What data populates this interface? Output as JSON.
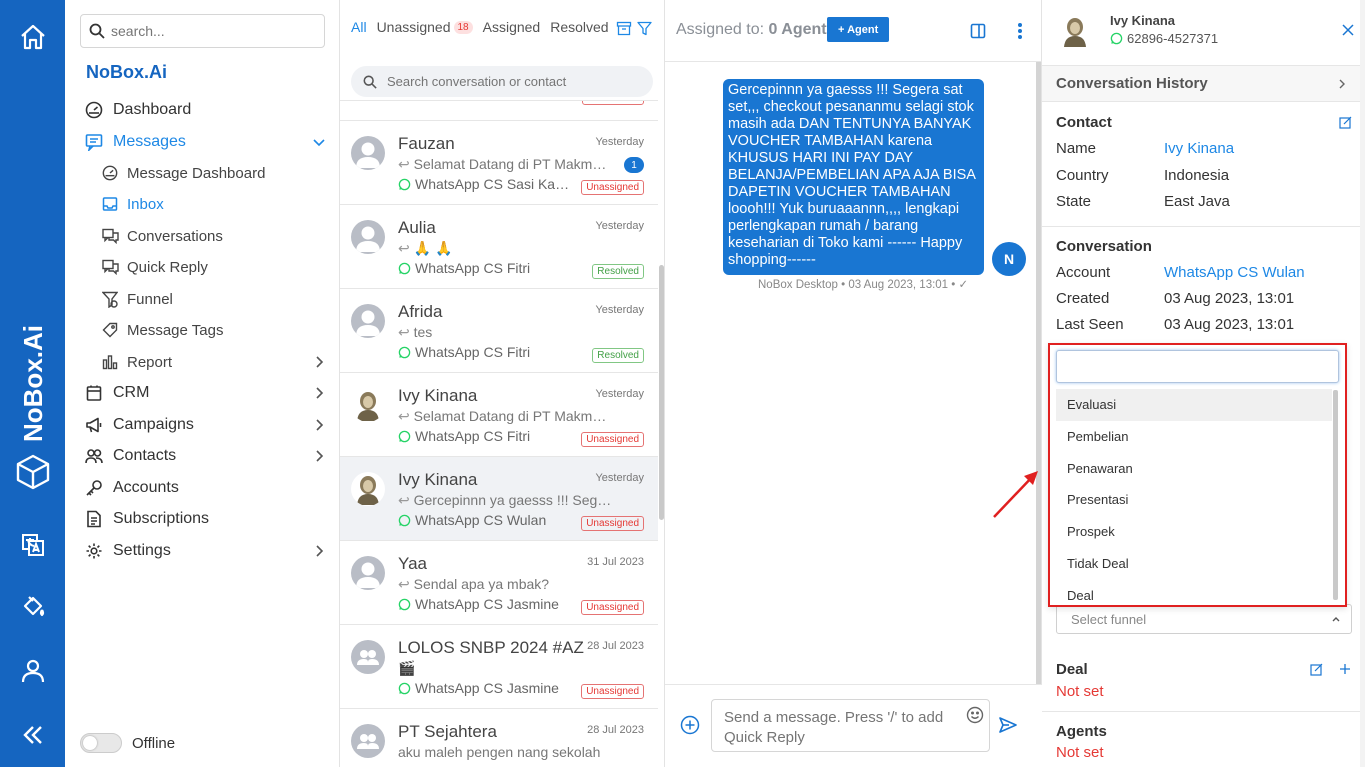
{
  "rail": {
    "brand": "NoBox.Ai",
    "icons": [
      "home-icon",
      "translate-icon",
      "paint-bucket-icon",
      "user-icon",
      "collapse-icon"
    ],
    "accent": "#1565c0"
  },
  "sidebar": {
    "search_placeholder": "search...",
    "brand": "NoBox.Ai",
    "items": [
      {
        "label": "Dashboard"
      },
      {
        "label": "Messages"
      },
      {
        "label": "Message Dashboard"
      },
      {
        "label": "Inbox"
      },
      {
        "label": "Conversations"
      },
      {
        "label": "Quick Reply"
      },
      {
        "label": "Funnel"
      },
      {
        "label": "Message Tags"
      },
      {
        "label": "Report"
      },
      {
        "label": "CRM"
      },
      {
        "label": "Campaigns"
      },
      {
        "label": "Contacts"
      },
      {
        "label": "Accounts"
      },
      {
        "label": "Subscriptions"
      },
      {
        "label": "Settings"
      }
    ],
    "status": "Offline"
  },
  "convlist": {
    "tabs": [
      "All",
      "Unassigned",
      "Assigned",
      "Resolved"
    ],
    "unassigned_count": "18",
    "search_placeholder": "Search conversation or contact",
    "items": [
      {
        "name": "Fauzan",
        "date": "Yesterday",
        "preview": "Selamat Datang di PT Makmur Sejahtera",
        "channel": "WhatsApp CS Sasi Kanti...",
        "badge": "Unassigned",
        "unread": "1"
      },
      {
        "name": "Aulia",
        "date": "Yesterday",
        "preview": "🙏 🙏",
        "channel": "WhatsApp CS Fitri",
        "badge": "Resolved"
      },
      {
        "name": "Afrida",
        "date": "Yesterday",
        "preview": "tes",
        "channel": "WhatsApp CS Fitri",
        "badge": "Resolved"
      },
      {
        "name": "Ivy Kinana",
        "date": "Yesterday",
        "preview": "Selamat Datang di PT Makmur Sejahtera",
        "channel": "WhatsApp CS Fitri",
        "badge": "Unassigned"
      },
      {
        "name": "Ivy Kinana",
        "date": "Yesterday",
        "preview": "Gercepinnn ya gaesss !!! Segera sat set",
        "channel": "WhatsApp CS Wulan",
        "badge": "Unassigned"
      },
      {
        "name": "Yaa",
        "date": "31 Jul 2023",
        "preview": "Sendal apa ya mbak?",
        "channel": "WhatsApp CS Jasmine",
        "badge": "Unassigned"
      },
      {
        "name": "LOLOS SNBP 2024 #AZ",
        "date": "28 Jul 2023",
        "preview": "🎬",
        "channel": "WhatsApp CS Jasmine",
        "badge": "Unassigned"
      },
      {
        "name": "PT Sejahtera",
        "date": "28 Jul 2023",
        "preview": "aku maleh pengen nang sekolah",
        "channel": "",
        "badge": ""
      }
    ]
  },
  "chat": {
    "assigned_label": "Assigned to:",
    "assigned_value": "0 Agent",
    "agent_button": "+ Agent",
    "message": "Gercepinnn ya gaesss !!! Segera sat set,,, checkout pesananmu selagi stok masih ada DAN TENTUNYA BANYAK VOUCHER TAMBAHAN karena KHUSUS HARI INI PAY DAY BELANJA/PEMBELIAN APA AJA BISA DAPETIN VOUCHER TAMBAHAN loooh!!! Yuk buruaaannn,,,, lengkapi perlengkapan rumah / barang keseharian di Toko kami ------ Happy shopping------",
    "meta": "NoBox Desktop • 03 Aug 2023, 13:01 • ✓",
    "sender_initial": "N",
    "composer_placeholder": "Send a message. Press '/' to add Quick Reply"
  },
  "panel": {
    "name": "Ivy Kinana",
    "phone": "62896-4527371",
    "history_title": "Conversation History",
    "contact_title": "Contact",
    "contact": [
      {
        "key": "Name",
        "value": "Ivy Kinana"
      },
      {
        "key": "Country",
        "value": "Indonesia"
      },
      {
        "key": "State",
        "value": "East Java"
      }
    ],
    "conversation_title": "Conversation",
    "conversation": [
      {
        "key": "Account",
        "value": "WhatsApp CS Wulan"
      },
      {
        "key": "Created",
        "value": "03 Aug 2023, 13:01"
      },
      {
        "key": "Last Seen",
        "value": "03 Aug 2023, 13:01"
      }
    ],
    "funnel_placeholder": "Select funnel",
    "funnel_options": [
      "Evaluasi",
      "Pembelian",
      "Penawaran",
      "Presentasi",
      "Prospek",
      "Tidak Deal",
      "Deal"
    ],
    "deal_title": "Deal",
    "deal_value": "Not set",
    "agents_title": "Agents",
    "agents_value": "Not set"
  },
  "colors": {
    "brand": "#1565c0",
    "link": "#1e88e5",
    "danger": "#e53935",
    "highlight_box": "#e02020"
  }
}
